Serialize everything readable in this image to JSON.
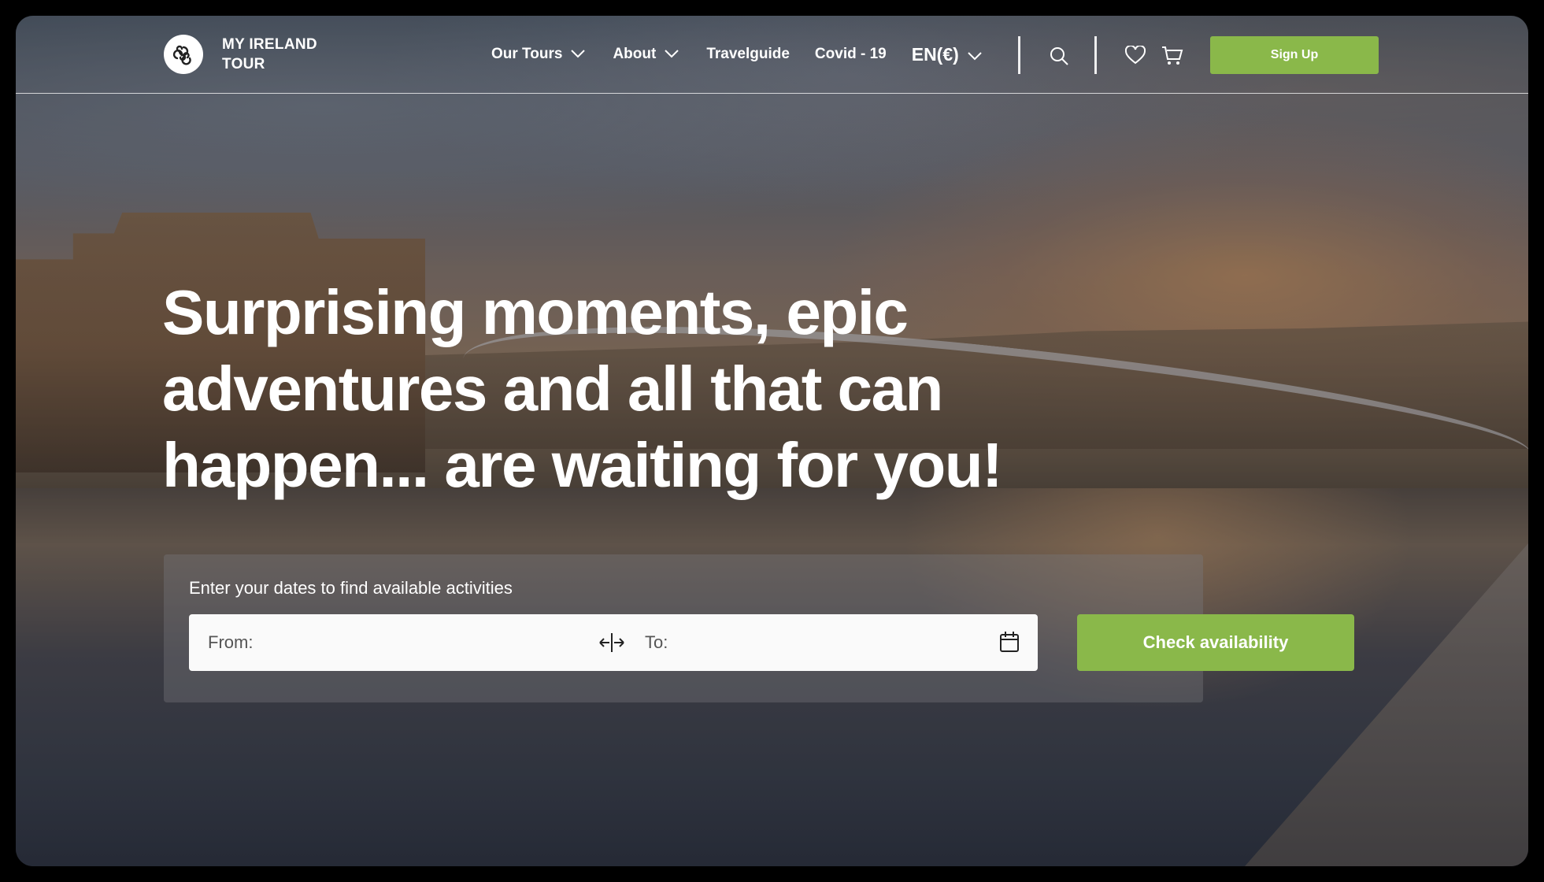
{
  "brand": {
    "name": "MY IRELAND TOUR",
    "logo_icon": "triskele-icon"
  },
  "nav": {
    "items": [
      {
        "label": "Our Tours",
        "has_dropdown": true
      },
      {
        "label": "About",
        "has_dropdown": true
      },
      {
        "label": "Travelguide",
        "has_dropdown": false
      },
      {
        "label": "Covid - 19",
        "has_dropdown": false
      }
    ],
    "language": "EN(€)",
    "icons": [
      "search-icon",
      "heart-icon",
      "cart-icon"
    ],
    "signup_label": "Sign Up"
  },
  "hero": {
    "title": "Surprising moments, epic adventures and all that can happen... are waiting for you!"
  },
  "search": {
    "prompt": "Enter your dates to find available activities",
    "from_label": "From:",
    "to_label": "To:",
    "button_label": "Check availability"
  },
  "colors": {
    "accent": "#8ab84a",
    "text": "#ffffff"
  }
}
